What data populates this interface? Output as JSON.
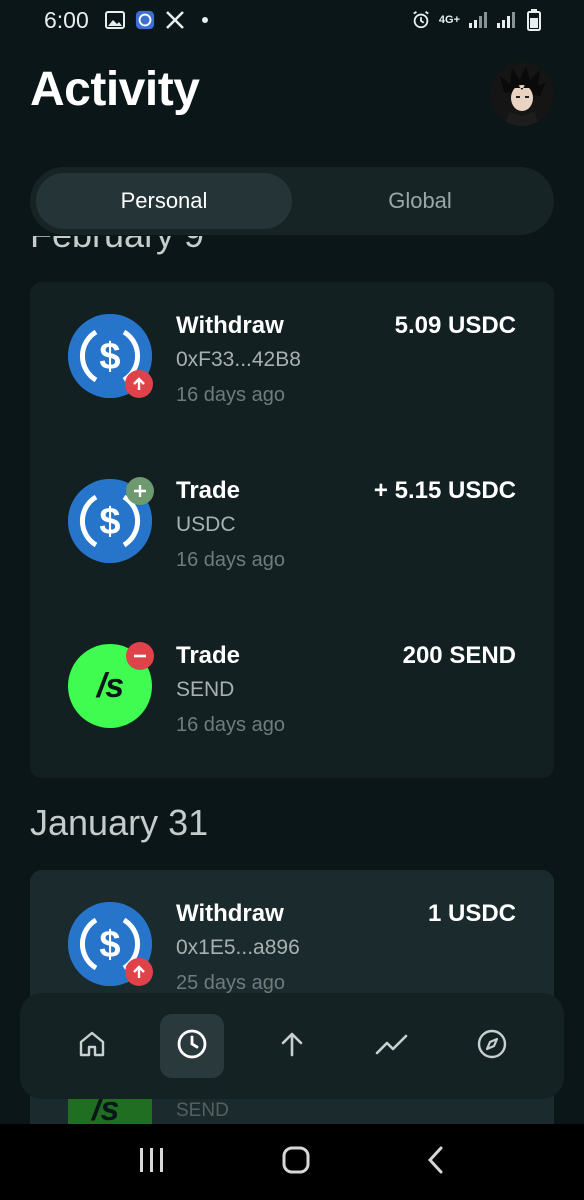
{
  "status_bar": {
    "time": "6:00",
    "network": "4G+"
  },
  "header": {
    "title": "Activity"
  },
  "tabs": [
    {
      "label": "Personal",
      "active": true
    },
    {
      "label": "Global",
      "active": false
    }
  ],
  "groups": [
    {
      "date": "February 9",
      "items": [
        {
          "title": "Withdraw",
          "subtitle": "0xF33...42B8",
          "time": "16 days ago",
          "amount": "5.09 USDC",
          "coin": "usdc",
          "badge": "outgoing"
        },
        {
          "title": "Trade",
          "subtitle": "USDC",
          "time": "16 days ago",
          "amount": "+ 5.15 USDC",
          "coin": "usdc",
          "badge": "plus"
        },
        {
          "title": "Trade",
          "subtitle": "SEND",
          "time": "16 days ago",
          "amount": "200 SEND",
          "coin": "send",
          "badge": "minus"
        }
      ]
    },
    {
      "date": "January 31",
      "items": [
        {
          "title": "Withdraw",
          "subtitle": "0x1E5...a896",
          "time": "25 days ago",
          "amount": "1 USDC",
          "coin": "usdc",
          "badge": "outgoing"
        }
      ]
    }
  ],
  "peek_item": {
    "subtitle": "SEND",
    "coin_glyph": "/s"
  },
  "coin_glyphs": {
    "send": "/s"
  },
  "bottom_nav": [
    {
      "name": "home-icon",
      "active": false
    },
    {
      "name": "activity-clock-icon",
      "active": true
    },
    {
      "name": "send-arrow-up-icon",
      "active": false
    },
    {
      "name": "trade-chart-icon",
      "active": false
    },
    {
      "name": "explore-compass-icon",
      "active": false
    }
  ],
  "colors": {
    "background": "#0b1618",
    "card": "#132022",
    "usdc_blue": "#2775ca",
    "send_green": "#40fb50",
    "badge_red": "#e0424a",
    "badge_green": "#6f9a70"
  }
}
